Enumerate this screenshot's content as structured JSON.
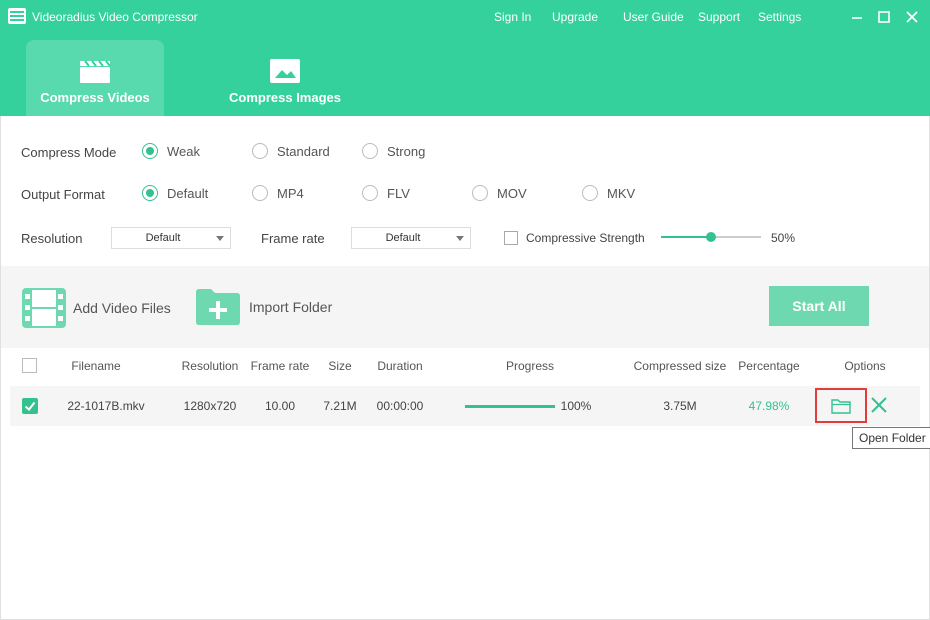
{
  "app": {
    "title": "Videoradius Video Compressor",
    "accent_color": "#34d19d"
  },
  "topnav": {
    "items": [
      "Sign In",
      "Upgrade",
      "User Guide",
      "Support",
      "Settings"
    ]
  },
  "window_controls": [
    "minimize-icon",
    "maximize-icon",
    "close-icon"
  ],
  "tabs": [
    {
      "label": "Compress Videos",
      "icon": "clapperboard-icon",
      "active": true
    },
    {
      "label": "Compress Images",
      "icon": "image-icon",
      "active": false
    }
  ],
  "settings": {
    "compress_mode": {
      "label": "Compress Mode",
      "options": [
        "Weak",
        "Standard",
        "Strong"
      ],
      "selected": "Weak"
    },
    "output_format": {
      "label": "Output Format",
      "options": [
        "Default",
        "MP4",
        "FLV",
        "MOV",
        "MKV"
      ],
      "selected": "Default"
    },
    "resolution": {
      "label": "Resolution",
      "value": "Default"
    },
    "frame_rate": {
      "label": "Frame rate",
      "value": "Default"
    },
    "compressive_strength": {
      "label": "Compressive Strength",
      "checked": false,
      "value_text": "50%",
      "level": 0.5
    }
  },
  "toolbar": {
    "add_video_files": "Add Video Files",
    "import_folder": "Import Folder",
    "start_all": "Start All"
  },
  "table": {
    "columns": [
      "Filename",
      "Resolution",
      "Frame rate",
      "Size",
      "Duration",
      "Progress",
      "Compressed size",
      "Percentage",
      "Options"
    ],
    "rows": [
      {
        "checked": true,
        "filename": "22-1017B.mkv",
        "resolution": "1280x720",
        "frame_rate": "10.00",
        "size": "7.21M",
        "duration": "00:00:00",
        "progress_text": "100%",
        "progress": 1.0,
        "compressed_size": "3.75M",
        "percentage": "47.98%"
      }
    ]
  },
  "tooltip": {
    "text": "Open Folder"
  }
}
